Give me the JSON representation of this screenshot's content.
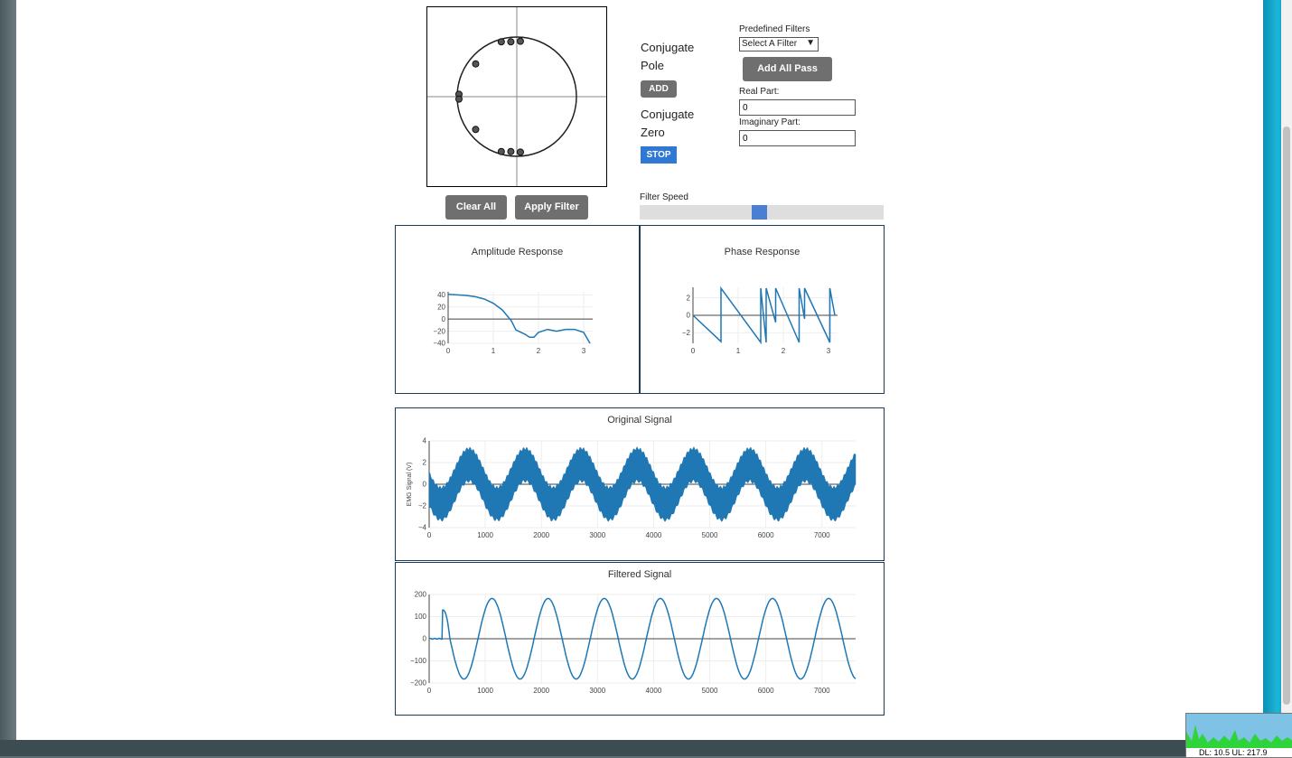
{
  "controls": {
    "conjugate_pole_label": "Conjugate Pole",
    "add_button": "ADD",
    "conjugate_zero_label": "Conjugate Zero",
    "stop_button": "STOP",
    "predefined_filters_label": "Predefined Filters",
    "filter_select_value": "Select A Filter",
    "add_all_pass_button": "Add All Pass",
    "real_part_label": "Real Part:",
    "real_part_value": "0",
    "imaginary_part_label": "Imaginary Part:",
    "imaginary_part_value": "0",
    "clear_all_button": "Clear All",
    "apply_filter_button": "Apply Filter",
    "filter_speed_label": "Filter Speed",
    "filter_speed_fraction": 0.49
  },
  "zplane": {
    "points": [
      {
        "re": -0.26,
        "im": 0.92
      },
      {
        "re": -0.1,
        "im": 0.92
      },
      {
        "re": 0.06,
        "im": 0.93
      },
      {
        "re": -0.69,
        "im": 0.55
      },
      {
        "re": -0.97,
        "im": 0.04
      },
      {
        "re": -0.97,
        "im": -0.04
      },
      {
        "re": -0.69,
        "im": -0.55
      },
      {
        "re": -0.26,
        "im": -0.92
      },
      {
        "re": -0.1,
        "im": -0.92
      },
      {
        "re": 0.06,
        "im": -0.93
      }
    ]
  },
  "chart_data": [
    {
      "type": "line",
      "title": "Amplitude Response",
      "x": [
        0,
        0.2,
        0.4,
        0.6,
        0.8,
        1.0,
        1.2,
        1.4,
        1.5,
        1.7,
        1.8,
        1.9,
        2.0,
        2.2,
        2.4,
        2.6,
        2.8,
        3.0,
        3.14
      ],
      "y": [
        41,
        40,
        39,
        37,
        33,
        26,
        15,
        -3,
        -18,
        -25,
        -30,
        -30,
        -22,
        -17,
        -20,
        -17,
        -17,
        -22,
        -40
      ],
      "xlim": [
        0,
        3.2
      ],
      "ylim": [
        -40,
        45
      ],
      "xticks": [
        0,
        1,
        2,
        3
      ],
      "yticks": [
        40,
        20,
        0,
        -20,
        -40
      ],
      "tick_labels_x": [
        "0",
        "1",
        "2",
        "3"
      ],
      "tick_labels_y": [
        "40",
        "20",
        "0",
        "−20",
        "−40"
      ]
    },
    {
      "type": "line",
      "title": "Phase Response",
      "x": [
        0,
        0.62,
        0.62,
        1.5,
        1.5,
        1.62,
        1.62,
        1.83,
        1.83,
        2.35,
        2.35,
        2.47,
        2.47,
        3.03,
        3.03,
        3.14
      ],
      "y": [
        0,
        -3.0,
        3.1,
        -3.1,
        3.1,
        -3.1,
        3.1,
        -0.8,
        3.1,
        -3.1,
        3.1,
        -0.4,
        3.1,
        -3.1,
        3.1,
        0
      ],
      "xlim": [
        0,
        3.2
      ],
      "ylim": [
        -3.2,
        3.2
      ],
      "xticks": [
        0,
        1,
        2,
        3
      ],
      "yticks": [
        2,
        0,
        -2
      ],
      "tick_labels_x": [
        "0",
        "1",
        "2",
        "3"
      ],
      "tick_labels_y": [
        "2",
        "0",
        "−2"
      ]
    },
    {
      "type": "line",
      "title": "Original Signal",
      "ylabel": "EMG Signal (V)",
      "x_range": [
        0,
        7600
      ],
      "ylim": [
        -4,
        4
      ],
      "period": 1000,
      "low_amplitude": 1.8,
      "high_amplitude": 1.5,
      "xticks": [
        0,
        1000,
        2000,
        3000,
        4000,
        5000,
        6000,
        7000
      ],
      "tick_labels_x": [
        "0",
        "1000",
        "2000",
        "3000",
        "4000",
        "5000",
        "6000",
        "7000"
      ],
      "yticks": [
        4,
        2,
        0,
        -2,
        -4
      ],
      "tick_labels_y": [
        "4",
        "2",
        "0",
        "−2",
        "−4"
      ]
    },
    {
      "type": "line",
      "title": "Filtered Signal",
      "x_range": [
        0,
        7600
      ],
      "ylim": [
        -200,
        200
      ],
      "period": 1000,
      "amplitude": 182,
      "transient_end": 250,
      "xticks": [
        0,
        1000,
        2000,
        3000,
        4000,
        5000,
        6000,
        7000
      ],
      "tick_labels_x": [
        "0",
        "1000",
        "2000",
        "3000",
        "4000",
        "5000",
        "6000",
        "7000"
      ],
      "yticks": [
        200,
        100,
        0,
        -100,
        -200
      ],
      "tick_labels_y": [
        "200",
        "100",
        "0",
        "−100",
        "−200"
      ]
    }
  ],
  "netmon": {
    "text": "DL: 10.5 UL: 217.9"
  }
}
